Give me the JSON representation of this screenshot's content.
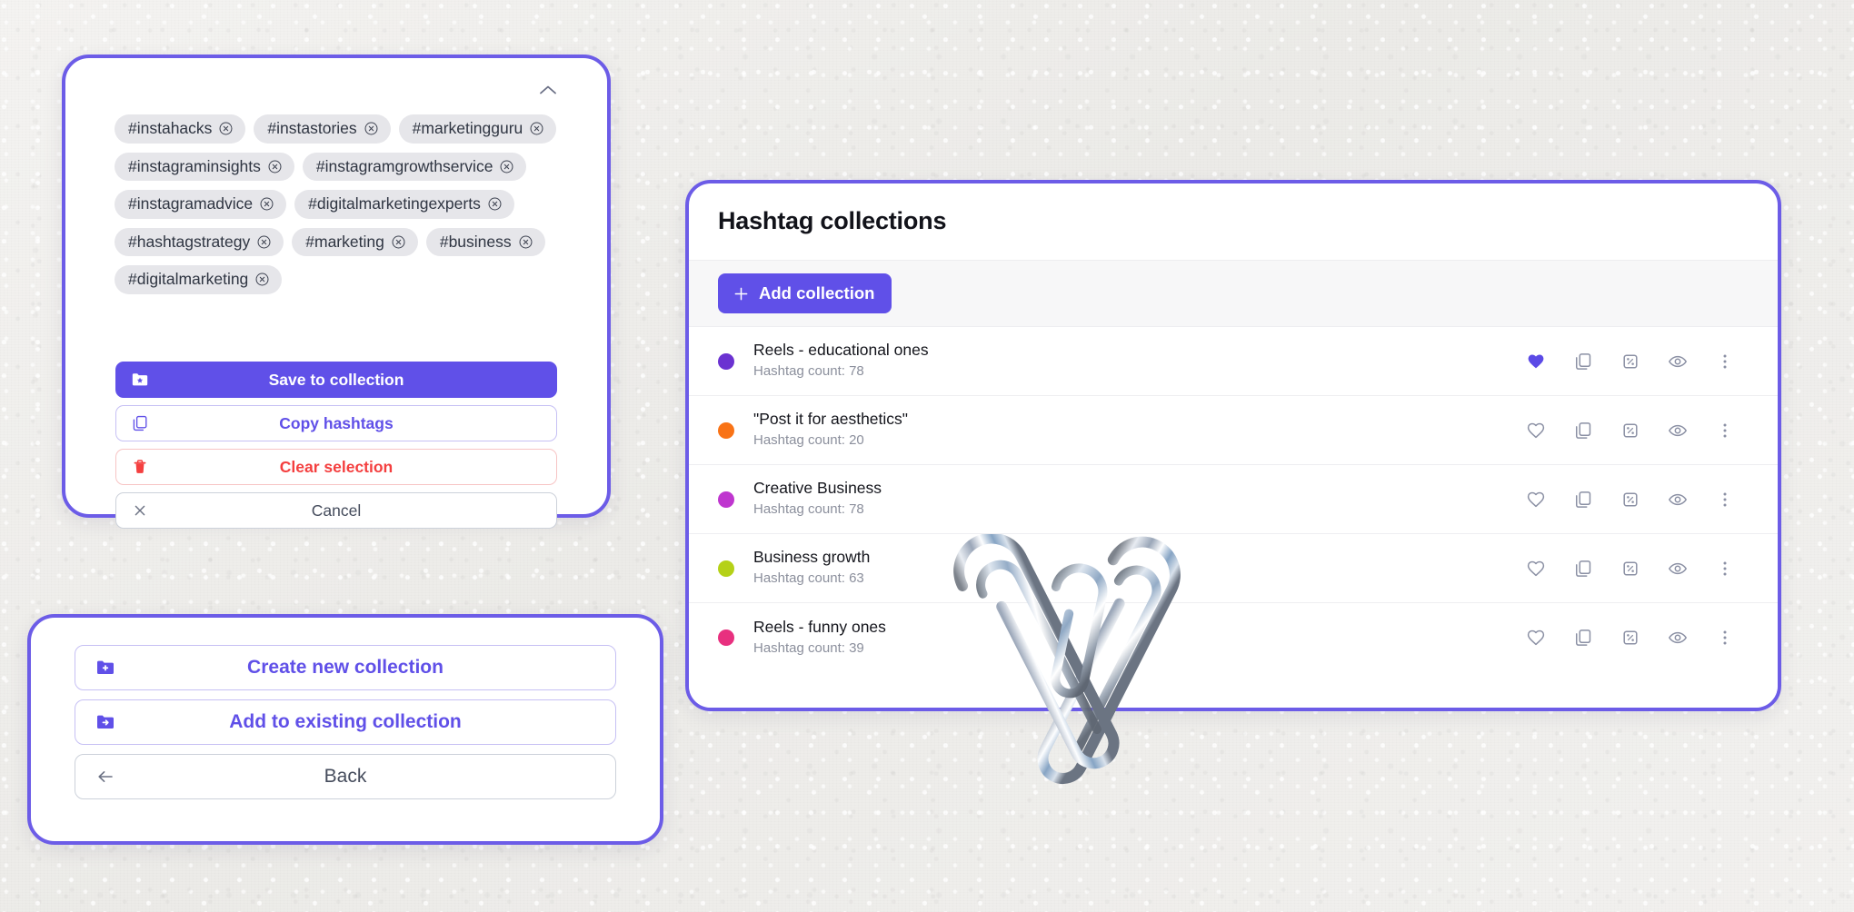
{
  "background": {
    "texture": "paper",
    "color": "#f1f0ee"
  },
  "theme": {
    "accent": "#6050e8",
    "accent_border": "#6c5ce7",
    "danger": "#f43f3f",
    "muted_text": "#8b8f9c"
  },
  "hashtag_selection_card": {
    "collapse_icon": "chevron-up-icon",
    "chips": [
      {
        "label": "#instahacks",
        "remove_icon": "circle-x-icon"
      },
      {
        "label": "#instastories",
        "remove_icon": "circle-x-icon"
      },
      {
        "label": "#marketingguru",
        "remove_icon": "circle-x-icon"
      },
      {
        "label": "#instagraminsights",
        "remove_icon": "circle-x-icon"
      },
      {
        "label": "#instagramgrowthservice",
        "remove_icon": "circle-x-icon"
      },
      {
        "label": "#instagramadvice",
        "remove_icon": "circle-x-icon"
      },
      {
        "label": "#digitalmarketingexperts",
        "remove_icon": "circle-x-icon"
      },
      {
        "label": "#hashtagstrategy",
        "remove_icon": "circle-x-icon"
      },
      {
        "label": "#marketing",
        "remove_icon": "circle-x-icon"
      },
      {
        "label": "#business",
        "remove_icon": "circle-x-icon"
      },
      {
        "label": "#digitalmarketing",
        "remove_icon": "circle-x-icon"
      }
    ],
    "actions": [
      {
        "label": "Save to collection",
        "icon": "folder-star-icon",
        "style": "primary"
      },
      {
        "label": "Copy hashtags",
        "icon": "copy-icon",
        "style": "outline-purple"
      },
      {
        "label": "Clear selection",
        "icon": "trash-icon",
        "style": "outline-red"
      },
      {
        "label": "Cancel",
        "icon": "close-x-icon",
        "style": "outline-gray"
      }
    ]
  },
  "collection_action_card": {
    "actions": [
      {
        "label": "Create new collection",
        "icon": "folder-plus-icon",
        "style": "outline-purple"
      },
      {
        "label": "Add to existing collection",
        "icon": "folder-arrow-icon",
        "style": "outline-purple"
      },
      {
        "label": "Back",
        "icon": "arrow-left-icon",
        "style": "outline-gray"
      }
    ]
  },
  "hashtag_collections_panel": {
    "title": "Hashtag collections",
    "add_button": {
      "label": "Add collection",
      "icon": "plus-icon"
    },
    "row_action_icons": [
      "heart-icon",
      "copy-icon",
      "shuffle-square-icon",
      "eye-icon",
      "more-vertical-icon"
    ],
    "collections": [
      {
        "name": "Reels - educational ones",
        "count_label": "Hashtag count: 78",
        "dot_color": "#6b32d1",
        "favorited": true
      },
      {
        "name": "\"Post it for aesthetics\"",
        "count_label": "Hashtag count: 20",
        "dot_color": "#f97316",
        "favorited": false
      },
      {
        "name": "Creative Business",
        "count_label": "Hashtag count: 78",
        "dot_color": "#bf36cf",
        "favorited": false
      },
      {
        "name": "Business growth",
        "count_label": "Hashtag count: 63",
        "dot_color": "#b5d117",
        "favorited": false
      },
      {
        "name": "Reels - funny ones",
        "count_label": "Hashtag count: 39",
        "dot_color": "#e8307f",
        "favorited": false
      }
    ]
  },
  "decoration": {
    "paperclips_icon": "paperclips-image"
  }
}
